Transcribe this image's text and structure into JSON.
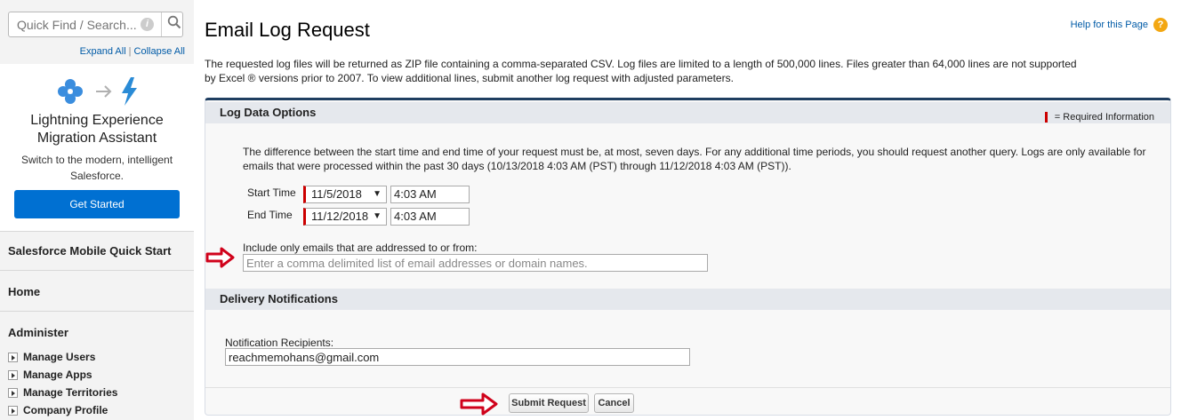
{
  "sidebar": {
    "search_placeholder": "Quick Find / Search...",
    "expand_all": "Expand All",
    "collapse_all": "Collapse All",
    "sep": "|",
    "lex": {
      "title_line1": "Lightning Experience",
      "title_line2": "Migration Assistant",
      "sub_line1": "Switch to the modern, intelligent",
      "sub_line2": "Salesforce.",
      "button": "Get Started"
    },
    "mobile_quick_start": "Salesforce Mobile Quick Start",
    "home": "Home",
    "administer": "Administer",
    "admin_items": [
      "Manage Users",
      "Manage Apps",
      "Manage Territories",
      "Company Profile"
    ]
  },
  "page": {
    "title": "Email Log Request",
    "help": "Help for this Page",
    "intro_line1": "The requested log files will be returned as ZIP file containing a comma-separated CSV. Log files are limited to a length of 500,000 lines. Files greater than 64,000 lines are not supported",
    "intro_line2": "by Excel ® versions prior to 2007. To view additional lines, submit another log request with adjusted parameters."
  },
  "log_options": {
    "heading": "Log Data Options",
    "required_legend": "= Required Information",
    "note_line1": "The difference between the start time and end time of your request must be, at most, seven days. For any additional time periods, you should request another query. Logs are only available for",
    "note_line2": "emails that were processed within the past 30 days (10/13/2018 4:03 AM (PST) through 11/12/2018 4:03 AM (PST)).",
    "start_label": "Start Time",
    "start_date": "11/5/2018",
    "start_time": "4:03 AM",
    "end_label": "End Time",
    "end_date": "11/12/2018",
    "end_time": "4:03 AM",
    "filter_label": "Include only emails that are addressed to or from:",
    "filter_placeholder": "Enter a comma delimited list of email addresses or domain names."
  },
  "delivery": {
    "heading": "Delivery Notifications",
    "recipients_label": "Notification Recipients:",
    "recipients_value": "reachmemohans@gmail.com"
  },
  "buttons": {
    "submit": "Submit Request",
    "cancel": "Cancel"
  },
  "colors": {
    "accent_blue": "#0070d2",
    "link": "#015ba7",
    "required": "#cc0000",
    "arrow": "#d0021b"
  }
}
